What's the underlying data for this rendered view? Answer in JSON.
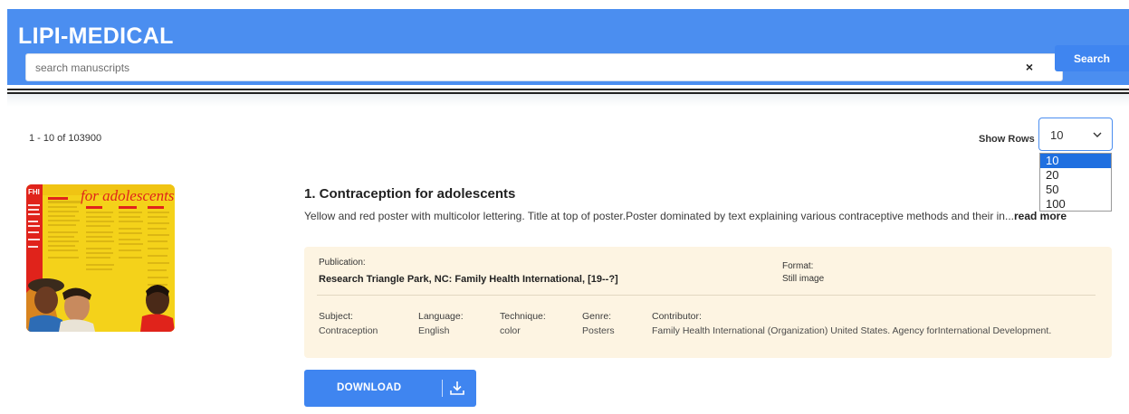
{
  "header": {
    "brand": "LIPI-MEDICAL",
    "search_placeholder": "search manuscripts",
    "clear_symbol": "×",
    "search_label": "Search"
  },
  "results": {
    "count_text": "1 - 10 of 103900",
    "show_rows_label": "Show Rows",
    "rows_selected": "10",
    "rows_options": [
      "10",
      "20",
      "50",
      "100"
    ]
  },
  "item": {
    "title": "1. Contraception for adolescents",
    "description": "Yellow and red poster with multicolor lettering. Title at top of poster.Poster dominated by text explaining various contraceptive methods and their in...",
    "read_more": "read more",
    "thumbnail_title": "for adolescents",
    "thumbnail_logo": "FHI",
    "publication_label": "Publication:",
    "publication_value": "Research Triangle Park, NC: Family Health International, [19--?]",
    "format_label": "Format:",
    "format_value": "Still image",
    "subject_label": "Subject:",
    "subject_value": "Contraception",
    "language_label": "Language:",
    "language_value": "English",
    "technique_label": "Technique:",
    "technique_value": "color",
    "genre_label": "Genre:",
    "genre_value": "Posters",
    "contributor_label": "Contributor:",
    "contributor_value": "Family Health International (Organization) United States. Agency forInternational Development.",
    "download_label": "DOWNLOAD"
  },
  "colors": {
    "header_blue": "#4b8ef0",
    "button_blue": "#3f85f0",
    "card_bg": "#fdf4e2",
    "poster_yellow": "#f4d21a",
    "poster_red": "#e0231b"
  }
}
